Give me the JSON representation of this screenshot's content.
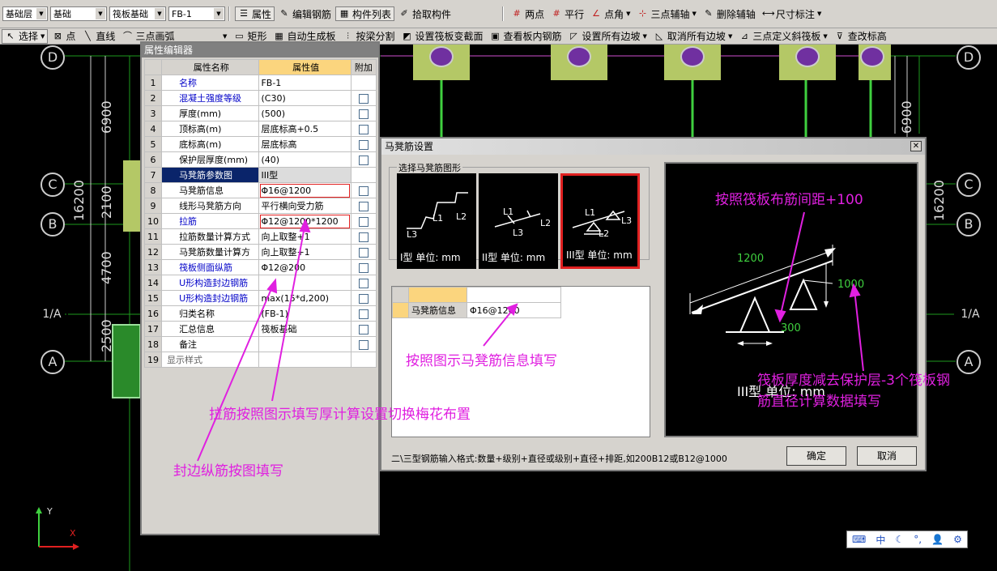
{
  "toolbar1": {
    "floor_select": "基础层",
    "category_select": "基础",
    "type_select": "筏板基础",
    "name_select": "FB-1",
    "btn_property": "属性",
    "btn_edit_rebar": "编辑钢筋",
    "btn_component_list": "构件列表",
    "btn_pick": "拾取构件",
    "btn_two_point": "两点",
    "btn_parallel": "平行",
    "btn_point_angle": "点角",
    "btn_three_point_aux": "三点辅轴",
    "btn_delete_aux": "删除辅轴",
    "btn_dimension": "尺寸标注"
  },
  "toolbar2": {
    "btn_select": "选择",
    "btn_point": "点",
    "btn_line": "直线",
    "btn_arc": "三点画弧",
    "btn_rect": "矩形",
    "btn_auto_gen": "自动生成板",
    "btn_split_by_beam": "按梁分割",
    "btn_set_section": "设置筏板变截面",
    "btn_view_rebar": "查看板内钢筋",
    "btn_set_slope": "设置所有边坡",
    "btn_cancel_slope": "取消所有边坡",
    "btn_three_point_slope": "三点定义斜筏板",
    "btn_check_elev": "查改标高"
  },
  "grid": {
    "axis_D": "D",
    "axis_C": "C",
    "axis_B": "B",
    "axis_1A": "1/A",
    "axis_A": "A",
    "dim_6900": "6900",
    "dim_16200": "16200",
    "dim_2100": "2100",
    "dim_4700": "4700",
    "dim_2500": "2500",
    "ucs_y": "Y",
    "ucs_x": "X"
  },
  "property_editor": {
    "title": "属性编辑器",
    "col_name": "属性名称",
    "col_value": "属性值",
    "col_extra": "附加",
    "rows": [
      {
        "n": "1",
        "k": "名称",
        "v": "FB-1"
      },
      {
        "n": "2",
        "k": "混凝土强度等级",
        "v": "(C30)"
      },
      {
        "n": "3",
        "k": "厚度(mm)",
        "v": "(500)"
      },
      {
        "n": "4",
        "k": "顶标高(m)",
        "v": "层底标高+0.5"
      },
      {
        "n": "5",
        "k": "底标高(m)",
        "v": "层底标高"
      },
      {
        "n": "6",
        "k": "保护层厚度(mm)",
        "v": "(40)"
      },
      {
        "n": "7",
        "k": "马凳筋参数图",
        "v": "III型"
      },
      {
        "n": "8",
        "k": "马凳筋信息",
        "v": "Φ16@1200"
      },
      {
        "n": "9",
        "k": "线形马凳筋方向",
        "v": "平行横向受力筋"
      },
      {
        "n": "10",
        "k": "拉筋",
        "v": "Φ12@1200*1200"
      },
      {
        "n": "11",
        "k": "拉筋数量计算方式",
        "v": "向上取整+1"
      },
      {
        "n": "12",
        "k": "马凳筋数量计算方",
        "v": "向上取整+1"
      },
      {
        "n": "13",
        "k": "筏板侧面纵筋",
        "v": "Φ12@200"
      },
      {
        "n": "14",
        "k": "U形构造封边钢筋",
        "v": ""
      },
      {
        "n": "15",
        "k": "U形构造封边钢筋",
        "v": "max(15*d,200)"
      },
      {
        "n": "16",
        "k": "归类名称",
        "v": "(FB-1)"
      },
      {
        "n": "17",
        "k": "汇总信息",
        "v": "筏板基础"
      },
      {
        "n": "18",
        "k": "备注",
        "v": ""
      },
      {
        "n": "19",
        "k": "显示样式",
        "v": ""
      }
    ]
  },
  "dialog": {
    "title": "马凳筋设置",
    "close": "✕",
    "group_label": "选择马凳筋图形",
    "type1_caption": "I型 单位: mm",
    "type2_caption": "II型 单位: mm",
    "type3_caption": "III型 单位: mm",
    "table_col": "",
    "table_row_label": "马凳筋信息",
    "table_row_value": "Φ16@1200",
    "hint": "二\\三型钢筋输入格式:数量+级别+直径或级别+直径+排距,如200B12或B12@1000",
    "ok": "确定",
    "cancel": "取消",
    "preview_1200": "1200",
    "preview_1000": "1000",
    "preview_300": "300",
    "preview_caption": "III型 单位: mm",
    "tile_L1": "L1",
    "tile_L2": "L2",
    "tile_L3": "L3"
  },
  "annotations": {
    "a1": "按照筏板布筋间距+100",
    "a2": "按照图示马凳筋信息填写",
    "a3": "筏板厚度减去保护层-3个筏板钢筋直径计算数据填写",
    "a3_line1": "筏板厚度减去保护层-3个筏板钢",
    "a3_line2": "筋直径计算数据填写",
    "a4": "拉筋按照图示填写厚计算设置切换梅花布置",
    "a5": "封边纵筋按图填写"
  },
  "status_tray": {
    "ime": "中"
  }
}
